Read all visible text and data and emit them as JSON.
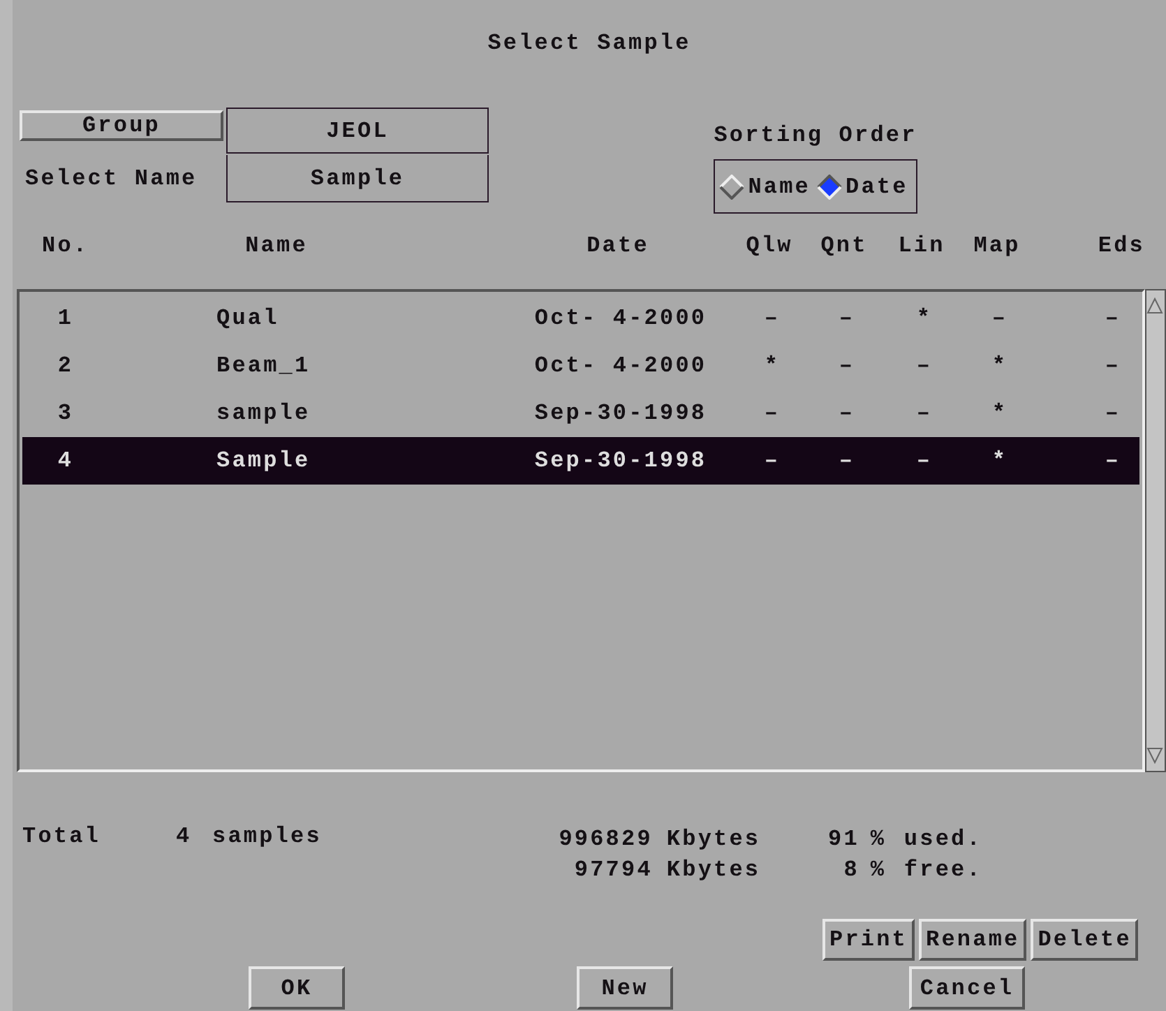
{
  "window": {
    "title": "Select Sample"
  },
  "group": {
    "button": "Group",
    "value": "JEOL"
  },
  "select_name": {
    "label": "Select Name",
    "value": "Sample"
  },
  "sorting": {
    "label": "Sorting Order",
    "options": [
      {
        "label": "Name",
        "selected": false
      },
      {
        "label": "Date",
        "selected": true
      }
    ]
  },
  "table": {
    "columns": [
      "No.",
      "Name",
      "Date",
      "Qlw",
      "Qnt",
      "Lin",
      "Map",
      "Eds"
    ],
    "rows": [
      {
        "cells": [
          "1",
          "Qual",
          "Oct- 4-2000",
          "–",
          "–",
          "*",
          "–",
          "–"
        ],
        "selected": false
      },
      {
        "cells": [
          "2",
          "Beam_1",
          "Oct- 4-2000",
          "*",
          "–",
          "–",
          "*",
          "–"
        ],
        "selected": false
      },
      {
        "cells": [
          "3",
          "sample",
          "Sep-30-1998",
          "–",
          "–",
          "–",
          "*",
          "–"
        ],
        "selected": false
      },
      {
        "cells": [
          "4",
          "Sample",
          "Sep-30-1998",
          "–",
          "–",
          "–",
          "*",
          "–"
        ],
        "selected": true
      }
    ]
  },
  "summary": {
    "total_label": "Total",
    "total_count": "4",
    "total_unit": "samples",
    "used": [
      "996829",
      "Kbytes",
      "91",
      "%",
      "used."
    ],
    "free": [
      "97794",
      "Kbytes",
      "8",
      "%",
      "free."
    ]
  },
  "action_buttons": [
    "Print",
    "Rename",
    "Delete"
  ],
  "dialog_buttons": [
    "OK",
    "New",
    "Cancel"
  ]
}
